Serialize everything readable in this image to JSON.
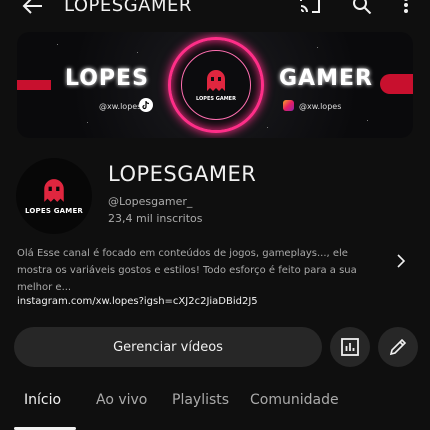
{
  "header": {
    "title": "LOPESGAMER",
    "icons": [
      "back-arrow-icon",
      "cast-icon",
      "search-icon",
      "more-vert-icon"
    ]
  },
  "banner": {
    "left_name": "LOPES",
    "right_name": "GAMER",
    "left_handle": "@xw.lopes",
    "right_handle": "@xw.lopes",
    "center_label": "LOPES GAMER",
    "accent_color": "#ff2e88",
    "ghost_color": "#e0263f"
  },
  "channel": {
    "avatar_label": "LOPES GAMER",
    "name": "LOPESGAMER",
    "handle": "@Lopesgamer_",
    "subscribers": "23,4 mil inscritos",
    "description": "Olá Esse canal é focado em conteúdos de jogos, gameplays..., ele mostra os variáveis gostos e estilos! Todo esforço é feito para a sua melhor e...",
    "link": "instagram.com/xw.lopes?igsh=cXJ2c2JiaDBid2J5"
  },
  "actions": {
    "manage_label": "Gerenciar vídeos",
    "icons": [
      "stats-icon",
      "edit-pencil-icon"
    ]
  },
  "tabs": [
    {
      "label": "Início",
      "active": true
    },
    {
      "label": "Ao vivo",
      "active": false
    },
    {
      "label": "Playlists",
      "active": false
    },
    {
      "label": "Comunidade",
      "active": false
    }
  ]
}
